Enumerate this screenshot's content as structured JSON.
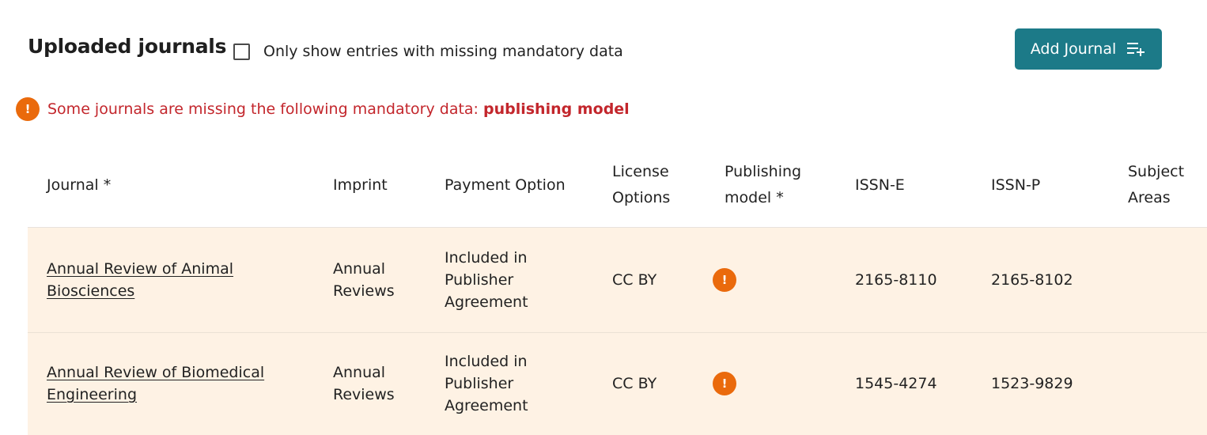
{
  "header": {
    "title": "Uploaded journals",
    "filter_label": "Only show entries with missing mandatory data",
    "filter_checked": false,
    "add_button_label": "Add Journal",
    "add_button_icon": "playlist-add-icon"
  },
  "alert": {
    "icon": "warning-icon",
    "message": "Some journals are missing the following mandatory data: ",
    "missing_field": "publishing model"
  },
  "colors": {
    "accent": "#1c7a88",
    "warning": "#ea6a0c",
    "error_text": "#c3262c",
    "row_highlight": "#fef2e4"
  },
  "table": {
    "columns": [
      "Journal *",
      "Imprint",
      "Payment Option",
      "License Options",
      "Publishing model *",
      "ISSN-E",
      "ISSN-P",
      "Subject Areas"
    ],
    "rows": [
      {
        "journal": "Annual Review of Animal Biosciences",
        "imprint": "Annual Reviews",
        "payment_option": "Included in Publisher Agreement",
        "license": "CC BY",
        "publishing_model_missing": true,
        "issn_e": "2165-8110",
        "issn_p": "2165-8102",
        "subject_areas": ""
      },
      {
        "journal": "Annual Review of Biomedical Engineering",
        "imprint": "Annual Reviews",
        "payment_option": "Included in Publisher Agreement",
        "license": "CC BY",
        "publishing_model_missing": true,
        "issn_e": "1545-4274",
        "issn_p": "1523-9829",
        "subject_areas": ""
      }
    ]
  }
}
